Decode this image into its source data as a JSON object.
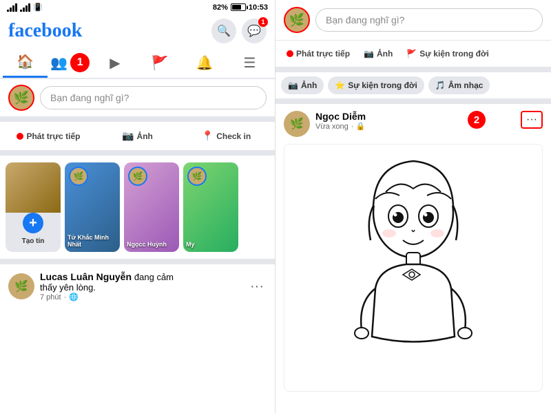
{
  "left": {
    "statusBar": {
      "signal": "signal",
      "wifi": "wifi",
      "battery": "82%",
      "time": "10:53"
    },
    "logo": "facebook",
    "header": {
      "searchLabel": "🔍",
      "messengerLabel": "💬",
      "notifCount": "1"
    },
    "nav": {
      "tabs": [
        {
          "icon": "🏠",
          "active": true,
          "label": "home"
        },
        {
          "icon": "👥",
          "active": false,
          "label": "friends",
          "badge": "1"
        },
        {
          "icon": "▶",
          "active": false,
          "label": "video"
        },
        {
          "icon": "🚩",
          "active": false,
          "label": "pages"
        },
        {
          "icon": "🔔",
          "active": false,
          "label": "notifications"
        },
        {
          "icon": "☰",
          "active": false,
          "label": "menu"
        }
      ]
    },
    "postBox": {
      "placeholder": "Bạn đang nghĩ gì?"
    },
    "actions": [
      {
        "icon": "🔴",
        "label": "Phát trực tiếp",
        "type": "live"
      },
      {
        "icon": "📷",
        "label": "Ảnh",
        "type": "photo"
      },
      {
        "icon": "📍",
        "label": "Check in",
        "type": "checkin"
      }
    ],
    "stories": [
      {
        "type": "create",
        "label": "Tạo tin"
      },
      {
        "type": "story",
        "name": "Tử Khắc Minh Nhất",
        "gradient": "purple"
      },
      {
        "type": "story",
        "name": "Ngọcc Huỳnh",
        "gradient": "pink"
      },
      {
        "type": "story",
        "name": "My",
        "gradient": "teal"
      }
    ],
    "post": {
      "author": "Lucas Luân Nguyễn",
      "action": "đang cảm thấy yên lòng.",
      "time": "7 phút",
      "privacy": "🌐",
      "moreBtn": "..."
    }
  },
  "right": {
    "postBox": {
      "placeholder": "Bạn đang nghĩ gì?"
    },
    "actions": [
      {
        "icon": "🔴",
        "label": "Phát trực tiếp",
        "type": "live"
      },
      {
        "icon": "📷",
        "label": "Ảnh",
        "type": "photo"
      },
      {
        "icon": "🚩",
        "label": "Sự kiện trong đời",
        "type": "event"
      }
    ],
    "extraActions": [
      {
        "icon": "📷",
        "label": "Ảnh"
      },
      {
        "icon": "⭐",
        "label": "Sự kiện trong đời"
      },
      {
        "icon": "🎵",
        "label": "Âm nhạc"
      }
    ],
    "post": {
      "author": "Ngọc Diễm",
      "time": "Vừa xong",
      "privacy": "🔒",
      "moreBtn": "···",
      "step2": "2"
    }
  }
}
